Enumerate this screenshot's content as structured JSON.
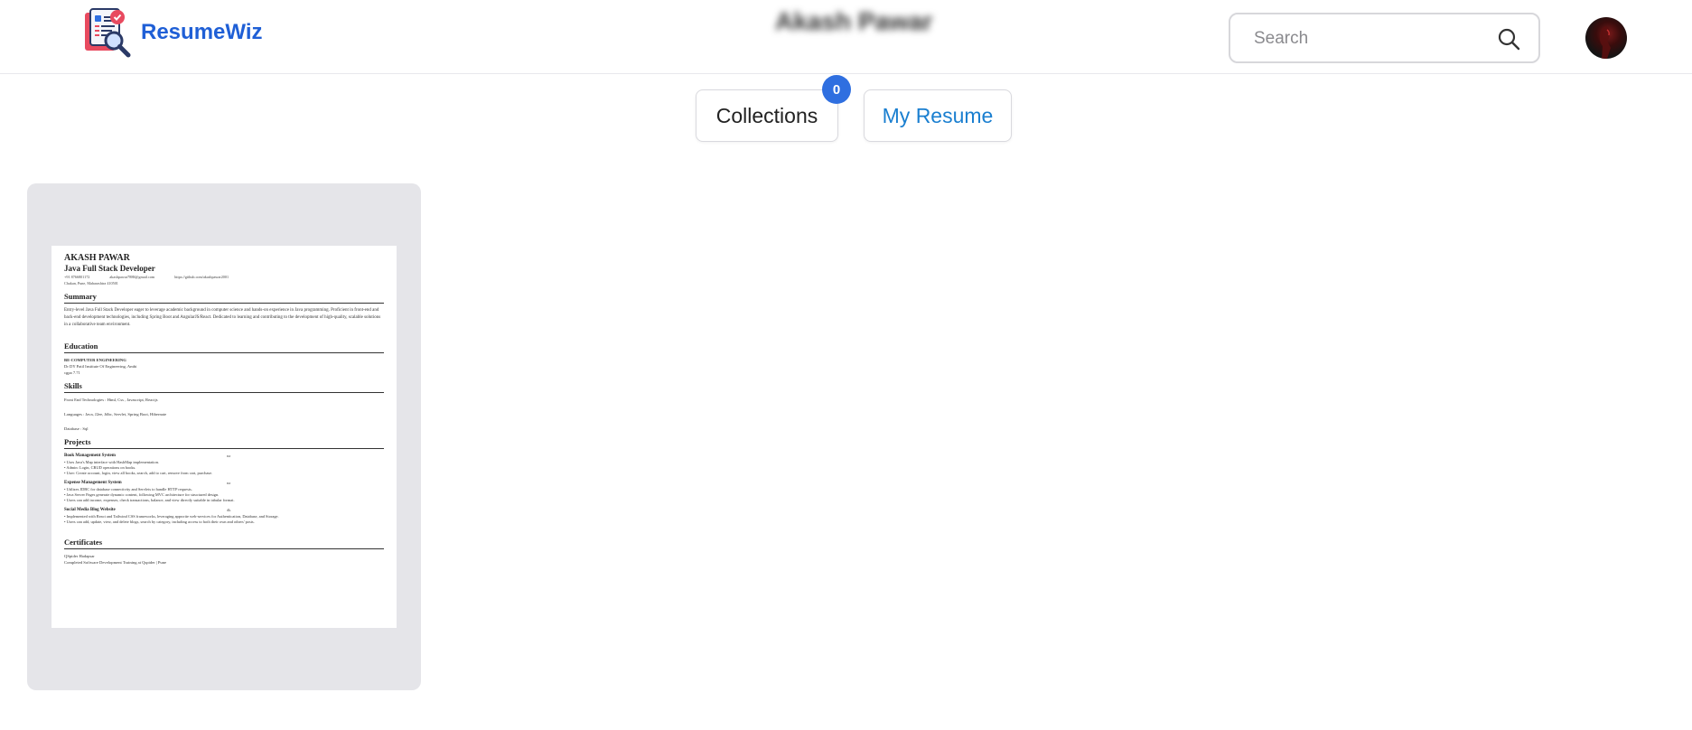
{
  "app": {
    "name": "ResumeWiz"
  },
  "user": {
    "display_name": "Akash Pawar"
  },
  "search": {
    "placeholder": "Search"
  },
  "tabs": {
    "collections": {
      "label": "Collections",
      "badge": "0"
    },
    "my_resume": {
      "label": "My Resume"
    }
  },
  "resume": {
    "name": "AKASH PAWAR",
    "role": "Java Full Stack Developer",
    "phone": "+91 8766801172",
    "email": "akashpawar7888@gmail.com",
    "link": "https://github.com/akashpawar2001",
    "location": "Chakan, Pune, Maharashtra 410501",
    "summary_title": "Summary",
    "summary_text": "Entry-level Java Full Stack Developer eager to leverage academic background in computer science and hands-on experience in Java programming. Proficient in front-end and back-end development technologies, including Spring Boot and AngularJS/React. Dedicated to learning and contributing to the development of high-quality, scalable solutions in a collaborative team environment.",
    "education_title": "Education",
    "education_degree": "BE-COMPUTER ENGINEERING",
    "education_school": "Dr DY Patil Institute Of Engineering, Ambi",
    "education_cgpa": "cgpa 7.71",
    "skills_title": "Skills",
    "skills_frontend": "Front End Technologies : Html, Css , Javascript, Reactjs",
    "skills_languages": "Languages : Java, J2ee, Jdbc, Servlet, Spring Boot, Hibernate",
    "skills_database": "Database : Sql",
    "projects_title": "Projects",
    "projects": [
      {
        "title": "Book Management System",
        "date": "na",
        "bullets": [
          "• Uses Java's Map interface with HashMap implementation.",
          "• Admin: Login, CRUD operations on books.",
          "• User: Create account, login, view all books, search, add to cart, remove from cart, purchase."
        ]
      },
      {
        "title": "Expense Management System",
        "date": "na",
        "bullets": [
          "• Utilizes JDBC for database connectivity and Servlets to handle HTTP requests.",
          "• Java Server Pages generate dynamic content, following MVC architecture for structured design.",
          "• Users can add income, expenses, check transactions, balance, and view directly suitable in tabular format."
        ]
      },
      {
        "title": "Social Media Blog Website",
        "date": "dk",
        "bullets": [
          "• Implemented with React and Tailwind CSS frameworks, leveraging appwrite web-services for Authentication, Database, and Storage.",
          "• Users can add, update, view, and delete blogs, search by category, including access to both their own and others' posts."
        ]
      }
    ],
    "certificates_title": "Certificates",
    "cert_org": "QSpider Hadapsar",
    "cert_desc": "Completed Software Development Training at Qspider | Pune"
  },
  "colors": {
    "brand": "#1f5fd6",
    "tab_active_text": "#1a7fd0",
    "badge_bg": "#2f6fe0",
    "card_bg": "#e5e5e9"
  },
  "icons": {
    "logo": "resume-magnifier-icon",
    "search": "search-icon"
  }
}
